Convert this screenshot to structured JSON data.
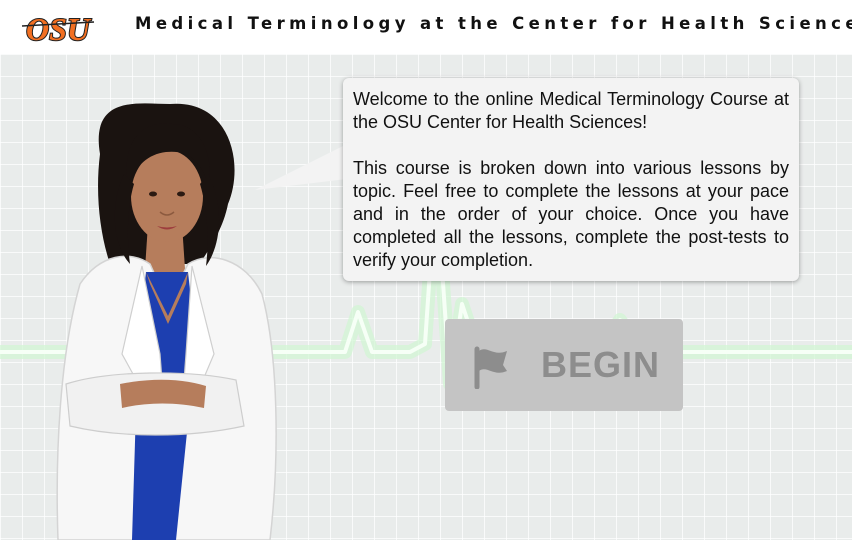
{
  "header": {
    "logo_text": "OSU",
    "title": "Medical Terminology at the Center for Health Sciences"
  },
  "bubble": {
    "paragraph1": "Welcome to the online Medical Terminology Course at the OSU Center for Health Sciences!",
    "paragraph2": "This course is broken down into various lessons by topic. Feel free to complete the lessons at your pace and in the order of your choice. Once you have completed all the lessons, complete the post-tests to verify your completion."
  },
  "begin_button": {
    "label": "BEGIN",
    "icon": "flag-icon"
  },
  "colors": {
    "header_bg": "#ffffff",
    "stage_bg": "#e9eceb",
    "ecg_glow": "#d6f7d8",
    "button_bg": "#c4c4c4",
    "button_text": "#8d8d8d",
    "osu_orange": "#f26f21",
    "scrubs_blue": "#1d3fb0"
  }
}
